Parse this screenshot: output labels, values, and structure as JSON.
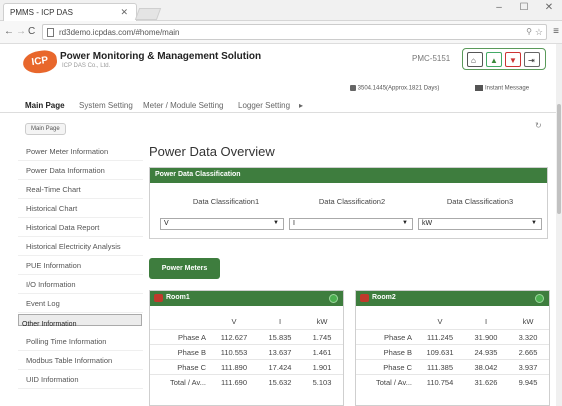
{
  "browser": {
    "tab_title": "PMMS - ICP DAS",
    "url": "rd3demo.icpdas.com/#home/main"
  },
  "header": {
    "logo_text": "ICP DAS",
    "title": "Power Monitoring & Management Solution",
    "company": "ICP DAS Co., Ltd.",
    "model": "PMC-5151",
    "status": "3504.1445(Approx.1821 Days)",
    "instant_message": "Instant Message"
  },
  "nav": {
    "items": [
      "Main Page",
      "System Setting",
      "Meter / Module Setting",
      "Logger Setting",
      "▸"
    ]
  },
  "breadcrumb": "Main Page",
  "sidebar": {
    "items": [
      "Power Meter Information",
      "Power Data Information",
      "Real-Time Chart",
      "Historical Chart",
      "Historical Data Report",
      "Historical Electricity Analysis",
      "PUE Information",
      "I/O Information",
      "Event Log",
      "Other Information",
      "Polling Time Information",
      "Modbus Table Information",
      "UID Information"
    ]
  },
  "main": {
    "title": "Power Data Overview",
    "classification": {
      "header": "Power Data Classification",
      "labels": [
        "Data Classification1",
        "Data Classification2",
        "Data Classification3"
      ],
      "selects": [
        "V",
        "I",
        "kW"
      ]
    },
    "power_meters_button": "Power Meters",
    "cards": [
      {
        "name": "Room1",
        "columns": [
          "V",
          "I",
          "kW"
        ],
        "rows": [
          [
            "Phase A",
            "112.627",
            "15.835",
            "1.745"
          ],
          [
            "Phase B",
            "110.553",
            "13.637",
            "1.461"
          ],
          [
            "Phase C",
            "111.890",
            "17.424",
            "1.901"
          ],
          [
            "Total / Av...",
            "111.690",
            "15.632",
            "5.103"
          ]
        ]
      },
      {
        "name": "Room2",
        "columns": [
          "V",
          "I",
          "kW"
        ],
        "rows": [
          [
            "Phase A",
            "111.245",
            "31.900",
            "3.320"
          ],
          [
            "Phase B",
            "109.631",
            "24.935",
            "2.665"
          ],
          [
            "Phase C",
            "111.385",
            "38.042",
            "3.937"
          ],
          [
            "Total / Av...",
            "110.754",
            "31.626",
            "9.945"
          ]
        ]
      }
    ]
  }
}
